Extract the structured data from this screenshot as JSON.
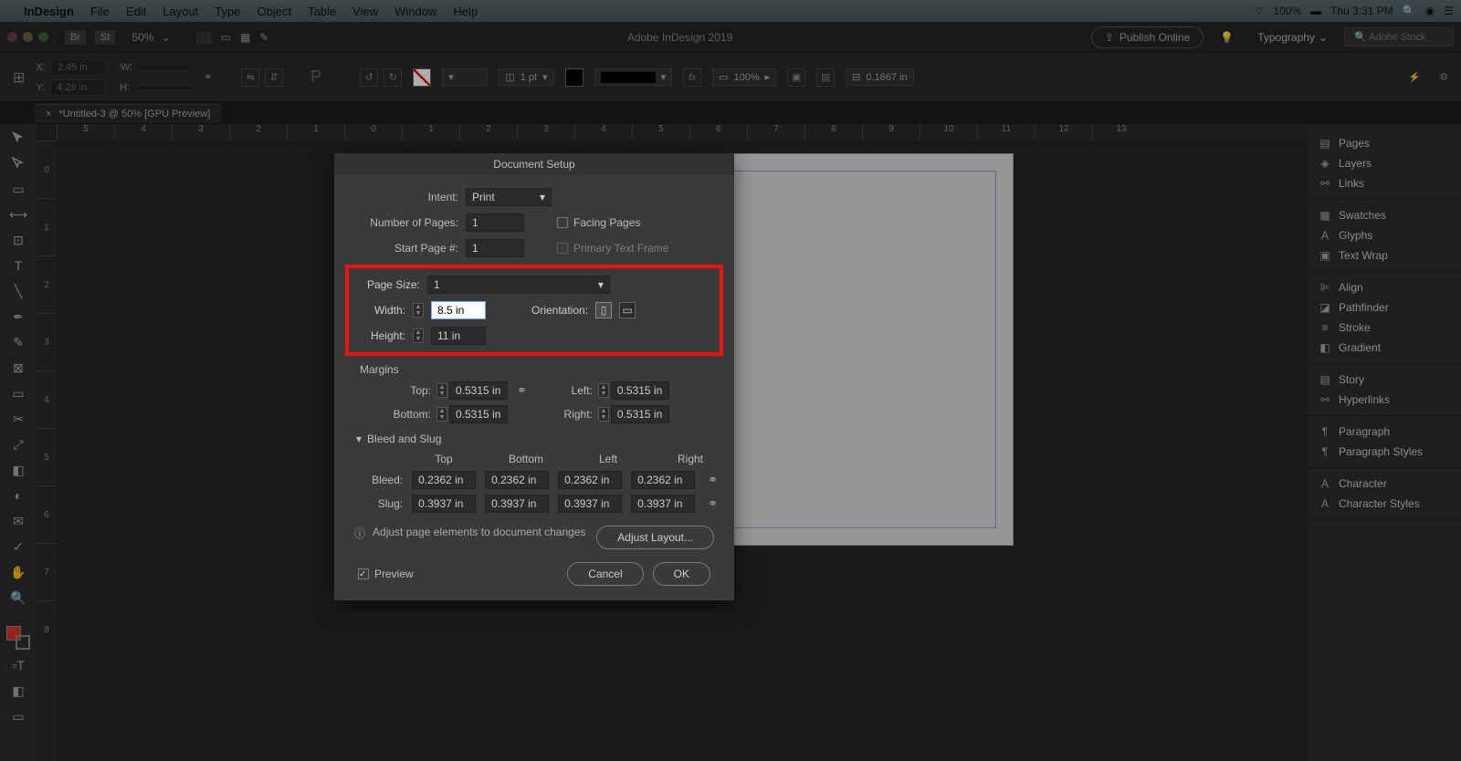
{
  "menubar": {
    "app": "InDesign",
    "items": [
      "File",
      "Edit",
      "Layout",
      "Type",
      "Object",
      "Table",
      "View",
      "Window",
      "Help"
    ],
    "battery": "100%",
    "clock": "Thu 3:31 PM"
  },
  "topbar": {
    "zoom": "50%",
    "title": "Adobe InDesign 2019",
    "publish": "Publish Online",
    "workspace": "Typography",
    "search_ph": "Adobe Stock"
  },
  "control": {
    "x": "2.45 in",
    "y": "4.26 in",
    "w": "",
    "h": "",
    "pt": "1 pt",
    "pct": "100%",
    "gap": "0.1667 in"
  },
  "doc_tab": "*Untitled-3 @ 50% [GPU Preview]",
  "ruler_h": [
    "5",
    "4",
    "3",
    "2",
    "1",
    "0",
    "1",
    "2",
    "3",
    "4",
    "5",
    "6",
    "7",
    "8",
    "9",
    "10",
    "11",
    "12",
    "13"
  ],
  "ruler_v": [
    "0",
    "1",
    "2",
    "3",
    "4",
    "5",
    "6",
    "7",
    "8"
  ],
  "panels": [
    [
      "Pages",
      "Layers",
      "Links"
    ],
    [
      "Swatches",
      "Glyphs",
      "Text Wrap"
    ],
    [
      "Align",
      "Pathfinder",
      "Stroke",
      "Gradient"
    ],
    [
      "Story",
      "Hyperlinks"
    ],
    [
      "Paragraph",
      "Paragraph Styles"
    ],
    [
      "Character",
      "Character Styles"
    ]
  ],
  "dialog": {
    "title": "Document Setup",
    "intent_lbl": "Intent:",
    "intent_val": "Print",
    "num_pages_lbl": "Number of Pages:",
    "num_pages": "1",
    "facing": "Facing Pages",
    "start_lbl": "Start Page #:",
    "start": "1",
    "primary": "Primary Text Frame",
    "page_size_lbl": "Page Size:",
    "page_size": "1",
    "width_lbl": "Width:",
    "width": "8.5 in",
    "height_lbl": "Height:",
    "height": "11 in",
    "orient_lbl": "Orientation:",
    "margins_lbl": "Margins",
    "top_lbl": "Top:",
    "bottom_lbl": "Bottom:",
    "left_lbl": "Left:",
    "right_lbl": "Right:",
    "m_top": "0.5315 in",
    "m_bottom": "0.5315 in",
    "m_left": "0.5315 in",
    "m_right": "0.5315 in",
    "bs_lbl": "Bleed and Slug",
    "col_top": "Top",
    "col_bottom": "Bottom",
    "col_left": "Left",
    "col_right": "Right",
    "bleed_lbl": "Bleed:",
    "slug_lbl": "Slug:",
    "b_top": "0.2362 in",
    "b_bottom": "0.2362 in",
    "b_left": "0.2362 in",
    "b_right": "0.2362 in",
    "s_top": "0.3937 in",
    "s_bottom": "0.3937 in",
    "s_left": "0.3937 in",
    "s_right": "0.3937 in",
    "note": "Adjust page elements to document changes",
    "adjust_btn": "Adjust Layout...",
    "preview": "Preview",
    "cancel": "Cancel",
    "ok": "OK"
  }
}
